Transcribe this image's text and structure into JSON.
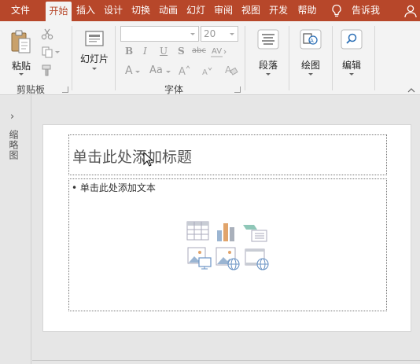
{
  "tabs": [
    {
      "label": "文件"
    },
    {
      "label": "开始"
    },
    {
      "label": "插入"
    },
    {
      "label": "设计"
    },
    {
      "label": "切换"
    },
    {
      "label": "动画"
    },
    {
      "label": "幻灯"
    },
    {
      "label": "审阅"
    },
    {
      "label": "视图"
    },
    {
      "label": "开发"
    },
    {
      "label": "帮助"
    }
  ],
  "tell_me": "告诉我",
  "ribbon": {
    "clipboard": {
      "paste_label": "粘贴",
      "group_label": "剪贴板"
    },
    "slides": {
      "new_slide_label": "幻灯片"
    },
    "font": {
      "group_label": "字体",
      "font_name_value": "",
      "font_size_value": "20",
      "bold": "B",
      "italic": "I",
      "underline": "U",
      "shadow": "S",
      "strike": "abc",
      "font_color": "A",
      "change_case": "Aa"
    },
    "paragraph": {
      "label": "段落"
    },
    "drawing": {
      "label": "绘图"
    },
    "editing": {
      "label": "编辑"
    }
  },
  "left_pane": {
    "label": "缩略图"
  },
  "slide": {
    "title_placeholder": "单击此处添加标题",
    "content_placeholder": "• 单击此处添加文本"
  },
  "colors": {
    "accent": "#b7472a",
    "ribbon_bg": "#f3f3f3",
    "workspace_bg": "#e6e6e6"
  }
}
